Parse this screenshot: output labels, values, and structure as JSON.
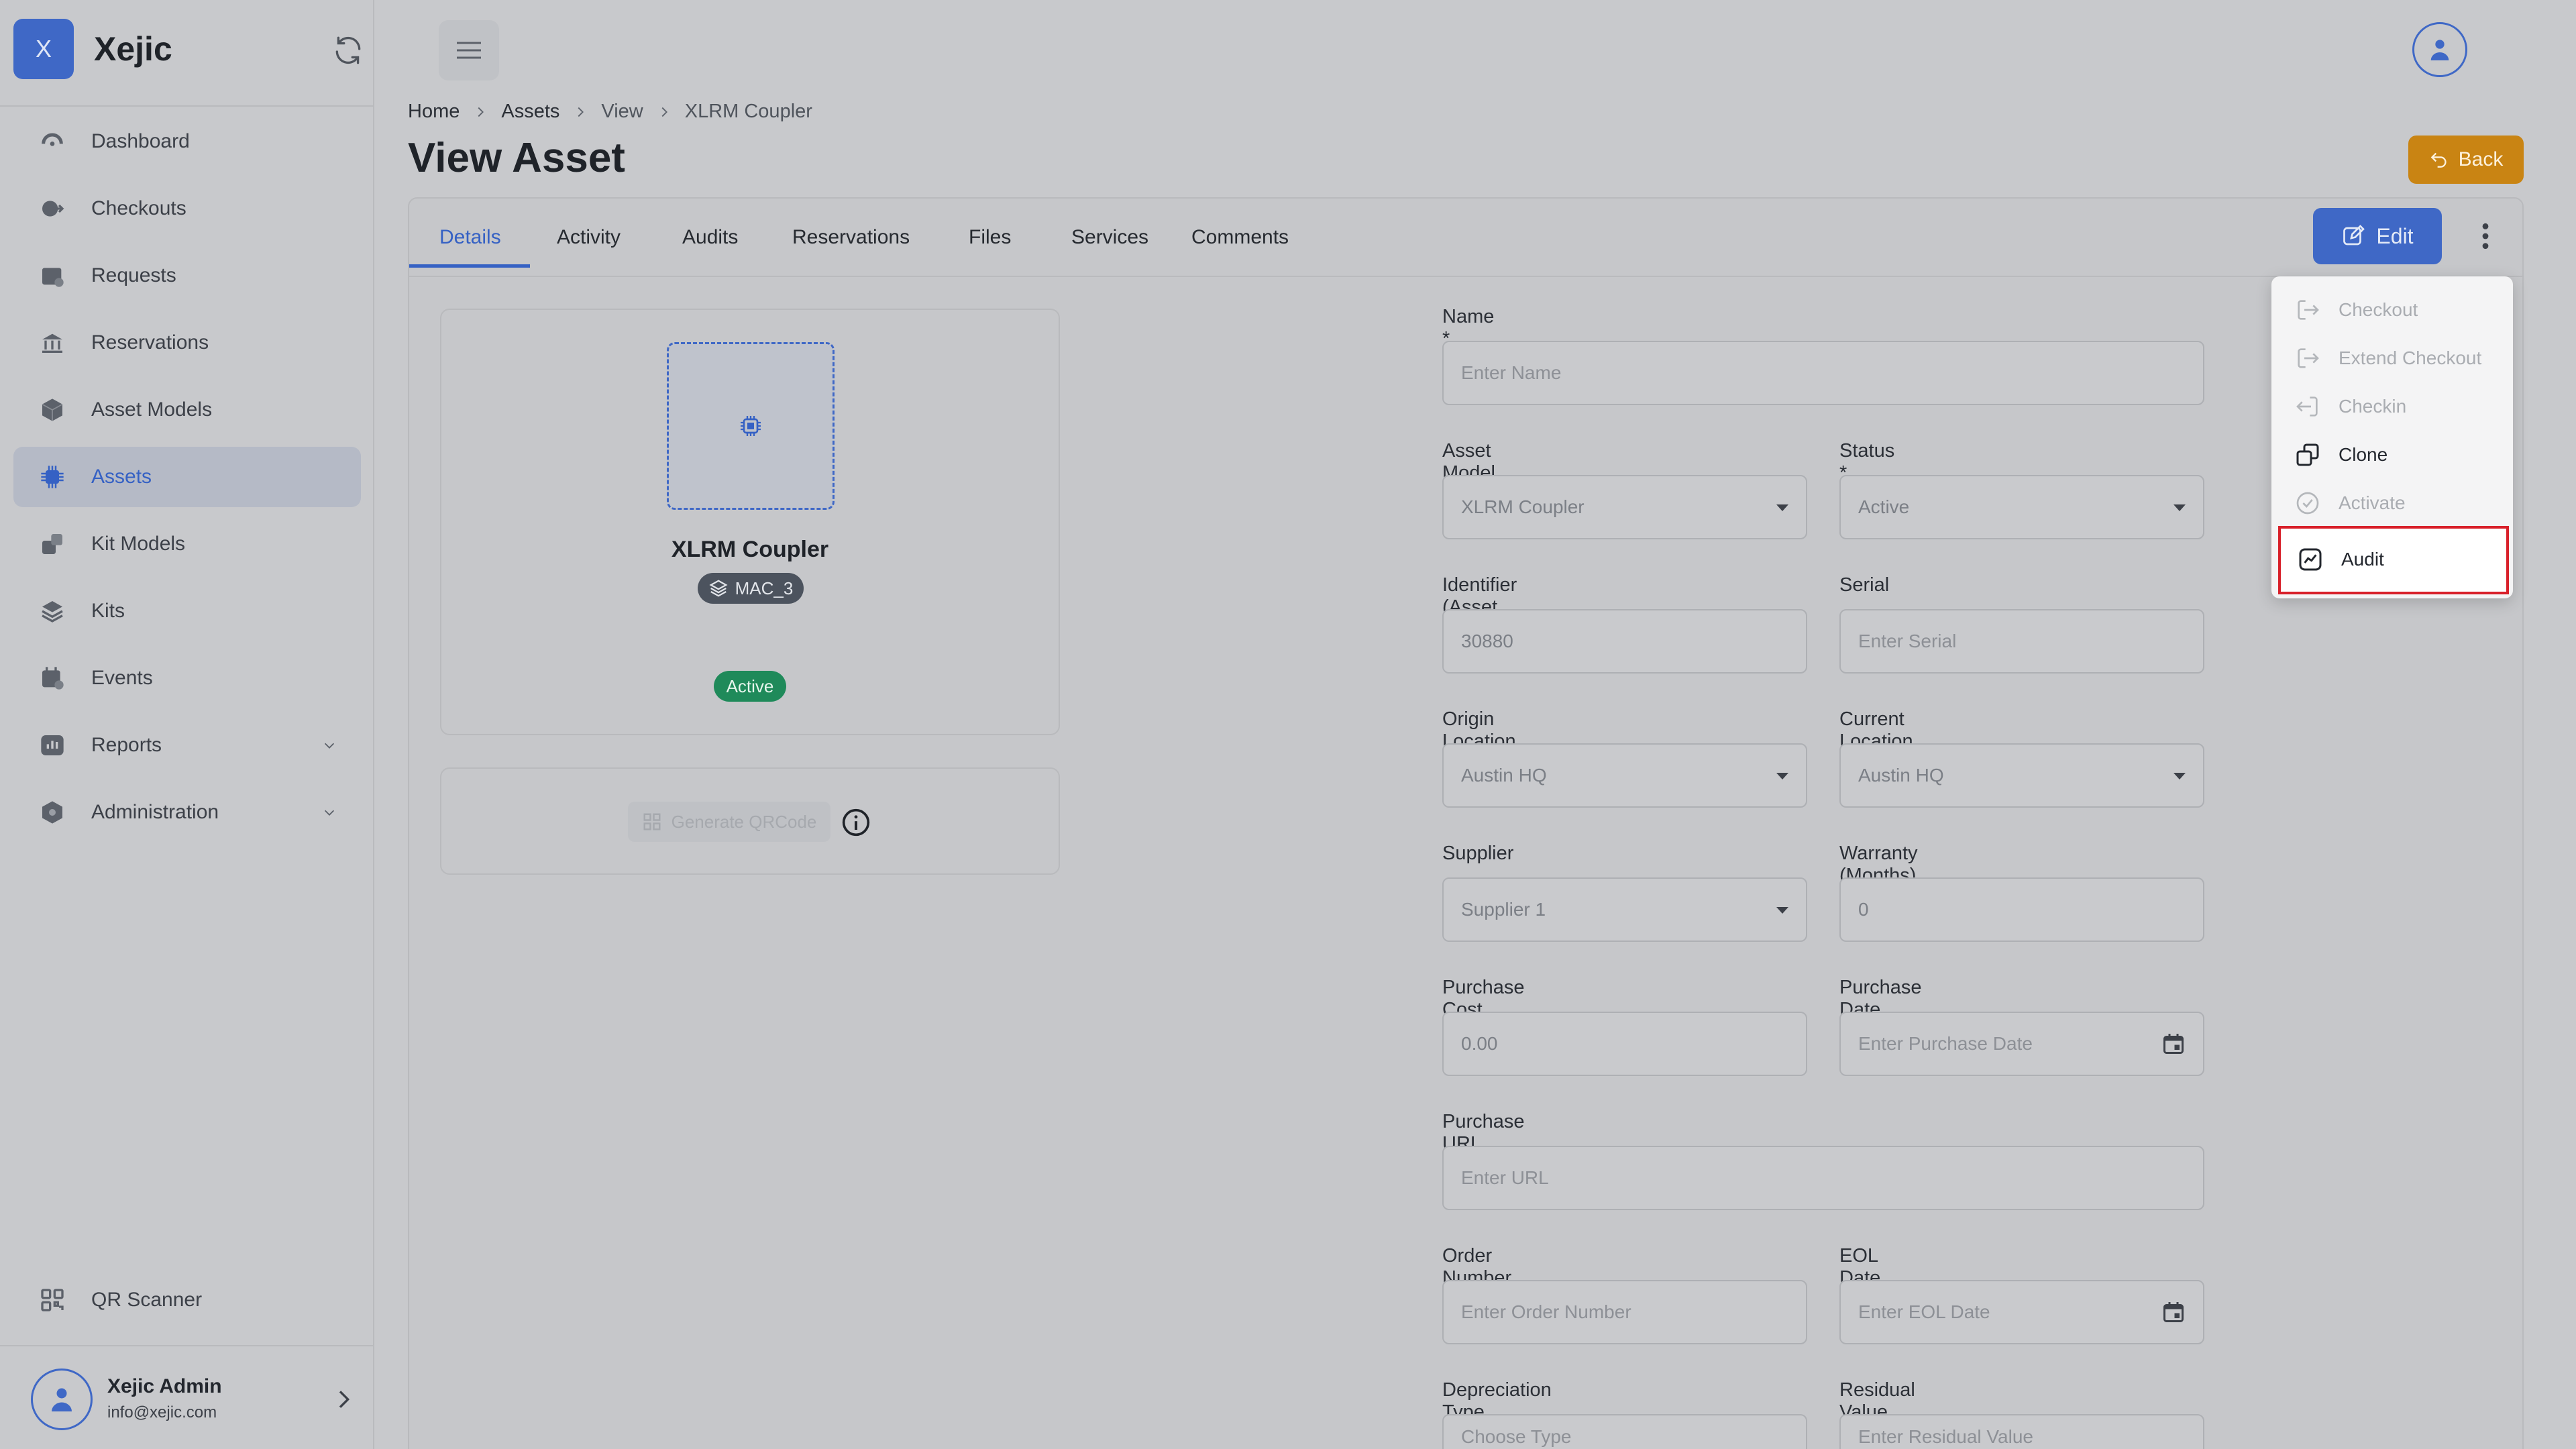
{
  "app": {
    "brand_letter": "X",
    "brand_name": "Xejic"
  },
  "sidebar": {
    "items": [
      {
        "label": "Dashboard",
        "icon": "dashboard-icon"
      },
      {
        "label": "Checkouts",
        "icon": "checkout-icon"
      },
      {
        "label": "Requests",
        "icon": "requests-icon"
      },
      {
        "label": "Reservations",
        "icon": "reservations-icon"
      },
      {
        "label": "Asset Models",
        "icon": "cube-icon"
      },
      {
        "label": "Assets",
        "icon": "chip-icon",
        "active": true
      },
      {
        "label": "Kit Models",
        "icon": "kit-models-icon"
      },
      {
        "label": "Kits",
        "icon": "layers-icon"
      },
      {
        "label": "Events",
        "icon": "calendar-icon"
      },
      {
        "label": "Reports",
        "icon": "reports-icon",
        "expandable": true
      },
      {
        "label": "Administration",
        "icon": "admin-icon",
        "expandable": true
      }
    ],
    "qr_scanner": "QR Scanner",
    "user": {
      "name": "Xejic Admin",
      "email": "info@xejic.com"
    }
  },
  "breadcrumb": [
    "Home",
    "Assets",
    "View",
    "XLRM Coupler"
  ],
  "page_title": "View Asset",
  "back_label": "Back",
  "tabs": [
    "Details",
    "Activity",
    "Audits",
    "Reservations",
    "Files",
    "Services",
    "Comments"
  ],
  "edit_label": "Edit",
  "asset": {
    "name": "XLRM Coupler",
    "model_badge": "MAC_3",
    "status": "Active",
    "qr_button": "Generate QRCode"
  },
  "form": {
    "name": {
      "label": "Name *",
      "placeholder": "Enter Name"
    },
    "asset_model": {
      "label": "Asset Model *",
      "value": "XLRM Coupler"
    },
    "status": {
      "label": "Status *",
      "value": "Active"
    },
    "identifier": {
      "label": "Identifier (Asset Tag)",
      "value": "30880"
    },
    "serial": {
      "label": "Serial",
      "placeholder": "Enter Serial"
    },
    "origin_location": {
      "label": "Origin Location *",
      "value": "Austin HQ"
    },
    "current_location": {
      "label": "Current Location",
      "value": "Austin HQ"
    },
    "supplier": {
      "label": "Supplier",
      "value": "Supplier 1"
    },
    "warranty": {
      "label": "Warranty (Months)",
      "value": "0"
    },
    "purchase_cost": {
      "label": "Purchase Cost",
      "value": "0.00"
    },
    "purchase_date": {
      "label": "Purchase Date",
      "placeholder": "Enter Purchase Date"
    },
    "purchase_url": {
      "label": "Purchase URL",
      "placeholder": "Enter URL"
    },
    "order_number": {
      "label": "Order Number",
      "placeholder": "Enter Order Number"
    },
    "eol_date": {
      "label": "EOL Date",
      "placeholder": "Enter EOL Date"
    },
    "depreciation_type": {
      "label": "Depreciation Type",
      "placeholder": "Choose Type"
    },
    "residual_value": {
      "label": "Residual Value",
      "placeholder": "Enter Residual Value"
    }
  },
  "menu": {
    "items": [
      {
        "label": "Checkout",
        "enabled": false
      },
      {
        "label": "Extend Checkout",
        "enabled": false
      },
      {
        "label": "Checkin",
        "enabled": false
      },
      {
        "label": "Clone",
        "enabled": true
      },
      {
        "label": "Activate",
        "enabled": false
      },
      {
        "label": "Audit",
        "enabled": true,
        "highlighted": true
      }
    ]
  },
  "colors": {
    "primary": "#3f68c6",
    "back_button": "#c98413",
    "active_status": "#1f8a5a",
    "highlight_border": "#d8202a"
  }
}
